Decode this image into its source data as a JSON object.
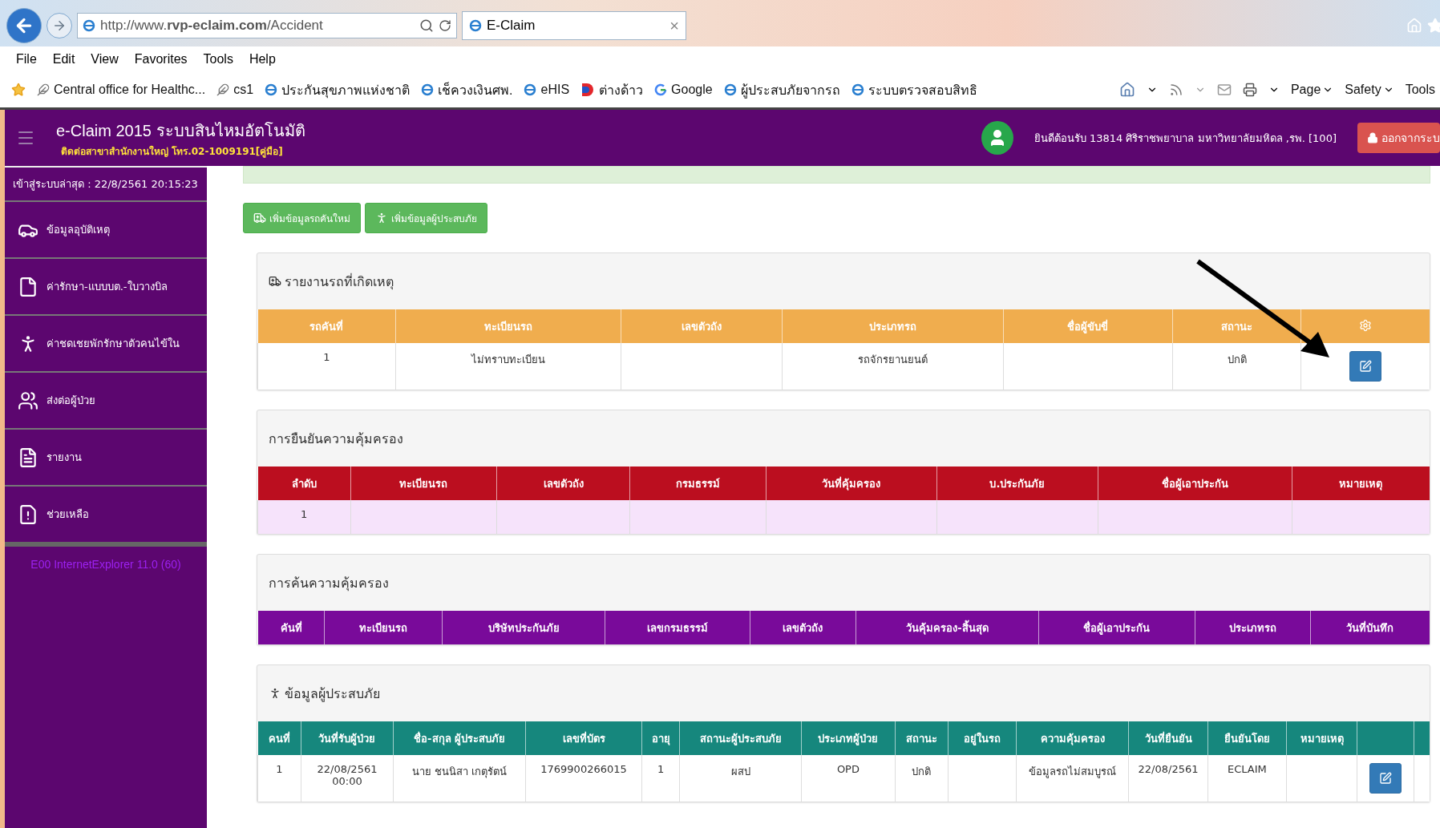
{
  "browser": {
    "address": "http://www.**rvp-eclaim.com**/Accident",
    "tab": {
      "title": "E-Claim",
      "close": "×"
    },
    "menu": [
      "File",
      "Edit",
      "View",
      "Favorites",
      "Tools",
      "Help"
    ],
    "favorites": [
      {
        "label": "Central office for Healthc...",
        "kind": "feather"
      },
      {
        "label": "cs1",
        "kind": "feather"
      },
      {
        "label": "ประกันสุขภาพแห่งชาติ",
        "kind": "ie"
      },
      {
        "label": "เช็ควงเงินศพ.",
        "kind": "ie"
      },
      {
        "label": "eHIS",
        "kind": "ie"
      },
      {
        "label": "ต่างด้าว",
        "kind": "d"
      },
      {
        "label": "Google",
        "kind": "g"
      },
      {
        "label": "ผู้ประสบภัยจากรถ",
        "kind": "ie"
      },
      {
        "label": "ระบบตรวจสอบสิทธิ",
        "kind": "ie"
      }
    ],
    "commands": [
      {
        "label": "Page"
      },
      {
        "label": "Safety"
      },
      {
        "label": "Tools"
      }
    ]
  },
  "header": {
    "title": "e-Claim 2015 ระบบสินไหมอัตโนมัติ",
    "subtitle": "ติดต่อสาขาสำนักงานใหญ่ โทร.02-1009191[คู่มือ]",
    "welcome": "ยินดีต้อนรับ 13814 ศิริราชพยาบาล มหาวิทยาลัยมหิดล ,รพ. [100]",
    "logout": "ออกจากระบ"
  },
  "sidebar": {
    "last_login": "เข้าสู่ระบบล่าสุด : 22/8/2561 20:15:23",
    "items": [
      {
        "label": "ข้อมูลอุบัติเหตุ",
        "kind": "accident"
      },
      {
        "label": "ค่ารักษา-แบบบต.-ใบวางบิล",
        "kind": "file"
      },
      {
        "label": "ค่าชดเชยพักรักษาตัวคนไข้ใน",
        "kind": "person"
      },
      {
        "label": "ส่งต่อผู้ป่วย",
        "kind": "transfer"
      },
      {
        "label": "รายงาน",
        "kind": "report"
      },
      {
        "label": "ช่วยเหลือ",
        "kind": "help"
      }
    ],
    "footer": "E00 InternetExplorer 11.0 (60)"
  },
  "actions": [
    {
      "label": "เพิ่มข้อมูลรถคันใหม่",
      "kind": "car"
    },
    {
      "label": "เพิ่มข้อมูลผู้ประสบภัย",
      "kind": "person"
    }
  ],
  "tables": [
    {
      "title": "รายงานรถที่เกิดเหตุ",
      "kind": "car",
      "color": "#f0ad4e",
      "columns": [
        "รถคันที่",
        "ทะเบียนรถ",
        "เลขตัวถัง",
        "ประเภทรถ",
        "ชื่อผู้ขับขี่",
        "สถานะ",
        {
          "kind": "settings"
        }
      ],
      "rows": [
        [
          "1",
          "ไม่ทราบทะเบียน",
          null,
          "รถจักรยานยนต์",
          null,
          "ปกติ",
          {
            "kind": "edit"
          }
        ]
      ]
    },
    {
      "title": "การยืนยันความคุ้มครอง",
      "color": "#bb0e1f",
      "columns": [
        "ลำดับ",
        "ทะเบียนรถ",
        "เลขตัวถัง",
        "กรมธรรม์",
        "วันที่คุ้มครอง",
        "บ.ประกันภัย",
        "ชื่อผู้เอาประกัน",
        "หมายเหตุ"
      ],
      "rows": [
        [
          "1",
          null,
          null,
          null,
          null,
          null,
          null,
          null
        ]
      ]
    },
    {
      "title": "การค้นความคุ้มครอง",
      "color": "#790a9a",
      "columns": [
        "คันที่",
        "ทะเบียนรถ",
        "บริษัทประกันภัย",
        "เลขกรมธรรม์",
        "เลขตัวถัง",
        "วันคุ้มครอง-สิ้นสุด",
        "ชื่อผู้เอาประกัน",
        "ประเภทรถ",
        "วันที่บันทึก"
      ]
    },
    {
      "title": "ข้อมูลผู้ประสบภัย",
      "kind": "person",
      "color": "#16877d",
      "columns": [
        "คนที่",
        "วันที่รับผู้ป่วย",
        "ชื่อ-สกุล ผู้ประสบภัย",
        "เลขที่บัตร",
        "อายุ",
        "สถานะผู้ประสบภัย",
        "ประเภทผู้ป่วย",
        "สถานะ",
        "อยู่ในรถ",
        "ความคุ้มครอง",
        "วันที่ยืนยัน",
        "ยืนยันโดย",
        "หมายเหตุ",
        null,
        null
      ],
      "rows": [
        [
          "1",
          "22/08/2561 00:00",
          "นาย ชนนิสา เกตุรัตน์",
          "1769900266015",
          "1",
          "ผสป",
          "OPD",
          "ปกติ",
          null,
          "ข้อมูลรถไม่สมบูรณ์",
          "22/08/2561",
          "ECLAIM",
          null,
          {
            "kind": "edit"
          },
          null
        ]
      ]
    }
  ]
}
